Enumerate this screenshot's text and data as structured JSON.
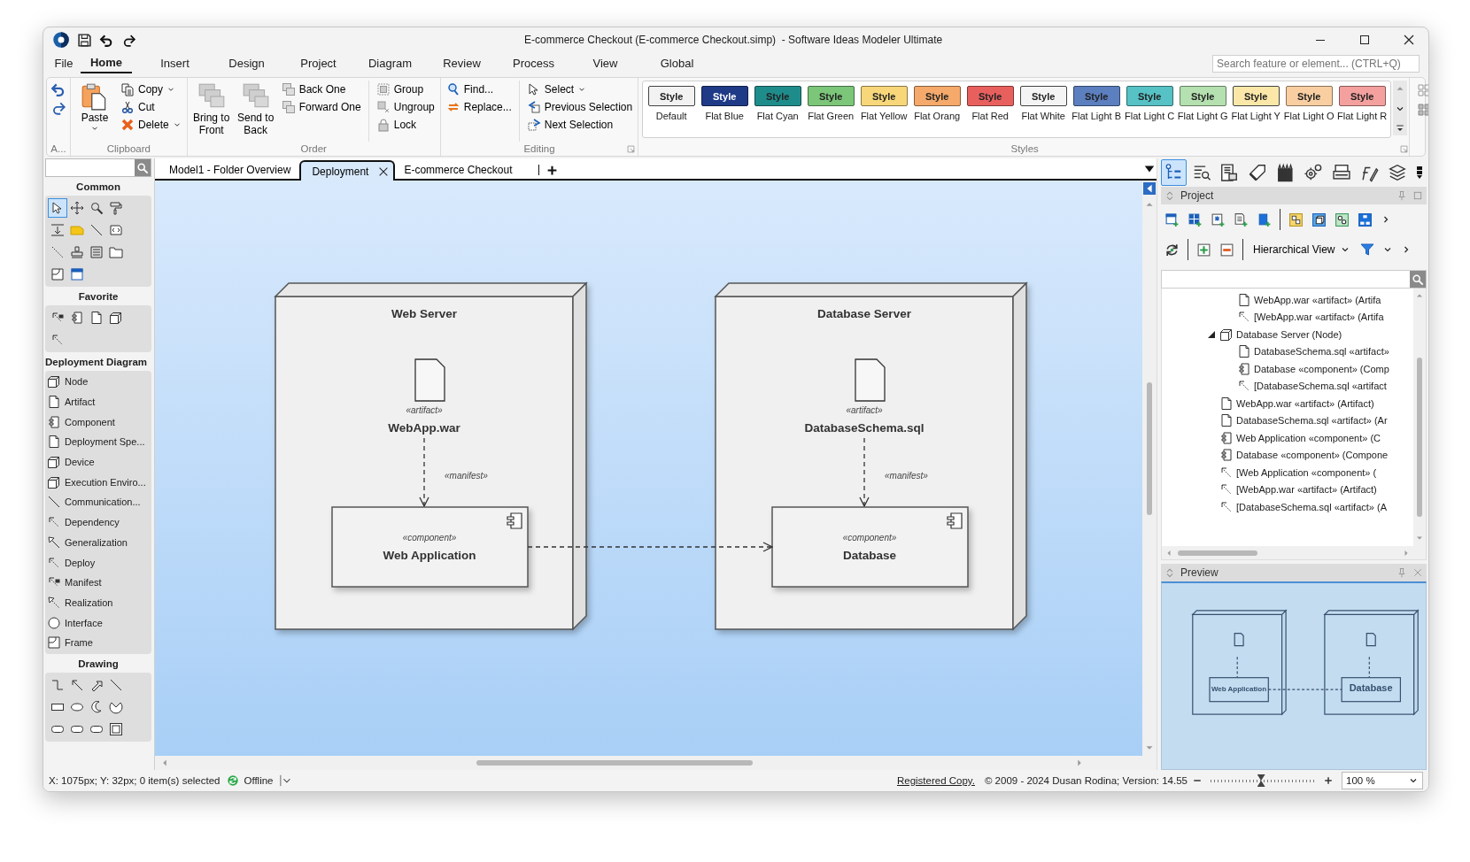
{
  "window": {
    "title": "E-commerce Checkout (E-commerce Checkout.simp)  - Software Ideas Modeler Ultimate"
  },
  "menu": [
    {
      "label": "File",
      "selected": false
    },
    {
      "label": "Home",
      "selected": true
    },
    {
      "label": "Insert",
      "selected": false
    },
    {
      "label": "Design",
      "selected": false
    },
    {
      "label": "Project",
      "selected": false
    },
    {
      "label": "Diagram",
      "selected": false
    },
    {
      "label": "Review",
      "selected": false
    },
    {
      "label": "Process",
      "selected": false
    },
    {
      "label": "View",
      "selected": false
    },
    {
      "label": "Global",
      "selected": false
    }
  ],
  "feature_search": {
    "placeholder": "Search feature or element... (CTRL+Q)"
  },
  "ribbon": [
    {
      "label": "A...",
      "columns": [
        [
          {
            "kind": "icon"
          },
          {
            "kind": "icon"
          }
        ]
      ]
    },
    {
      "label": "Clipboard",
      "columns": [
        [
          {
            "kind": "large",
            "label": "Paste",
            "dropdown": true
          }
        ],
        [
          {
            "kind": "small",
            "label": "Copy",
            "dropdown": true
          },
          {
            "kind": "small",
            "label": "Cut",
            "dropdown": false
          },
          {
            "kind": "small",
            "label": "Delete",
            "dropdown": true
          }
        ]
      ]
    },
    {
      "label": "Order",
      "columns": [
        [
          {
            "kind": "large",
            "label": "Bring to Front",
            "dropdown": false
          }
        ],
        [
          {
            "kind": "large",
            "label": "Send to Back",
            "dropdown": false
          }
        ],
        [
          {
            "kind": "small",
            "label": "Back One",
            "dropdown": false
          },
          {
            "kind": "small",
            "label": "Forward One",
            "dropdown": false
          }
        ],
        [
          {
            "kind": "small",
            "label": "Group",
            "dropdown": false
          },
          {
            "kind": "small",
            "label": "Ungroup",
            "dropdown": false
          },
          {
            "kind": "small",
            "label": "Lock",
            "dropdown": false
          }
        ]
      ]
    },
    {
      "label": "Editing",
      "columns": [
        [
          {
            "kind": "small",
            "label": "Find...",
            "dropdown": false
          },
          {
            "kind": "small",
            "label": "Replace...",
            "dropdown": false
          }
        ],
        [
          {
            "kind": "small",
            "label": "Select",
            "dropdown": true
          },
          {
            "kind": "small",
            "label": "Previous Selection",
            "dropdown": false
          },
          {
            "kind": "small",
            "label": "Next Selection",
            "dropdown": false
          }
        ]
      ]
    }
  ],
  "styles": {
    "label": "Styles",
    "items": [
      {
        "swatch": "Style",
        "name": "Default",
        "color": "#f2f2f2"
      },
      {
        "swatch": "Style",
        "name": "Flat Blue",
        "color": "#1f3a86"
      },
      {
        "swatch": "Style",
        "name": "Flat Cyan",
        "color": "#1f8c8c"
      },
      {
        "swatch": "Style",
        "name": "Flat Green",
        "color": "#7cc67a"
      },
      {
        "swatch": "Style",
        "name": "Flat Yellow",
        "color": "#f7d77a"
      },
      {
        "swatch": "Style",
        "name": "Flat Orang",
        "color": "#f5a96b"
      },
      {
        "swatch": "Style",
        "name": "Flat Red",
        "color": "#e8605e"
      },
      {
        "swatch": "Style",
        "name": "Flat White",
        "color": "#f4f4f4"
      },
      {
        "swatch": "Style",
        "name": "Flat Light B",
        "color": "#5b7fbf"
      },
      {
        "swatch": "Style",
        "name": "Flat Light C",
        "color": "#56c2c5"
      },
      {
        "swatch": "Style",
        "name": "Flat Light G",
        "color": "#b5e0b0"
      },
      {
        "swatch": "Style",
        "name": "Flat Light Y",
        "color": "#fbe8a8"
      },
      {
        "swatch": "Style",
        "name": "Flat Light O",
        "color": "#f9cfa2"
      },
      {
        "swatch": "Style",
        "name": "Flat Light R",
        "color": "#f3a09e"
      }
    ]
  },
  "toolbox": {
    "sections": [
      {
        "title": "Common",
        "kind": "icons",
        "tools": [
          {
            "selected": true
          },
          {
            "selected": false
          },
          {
            "selected": false
          },
          {
            "selected": false
          },
          {
            "selected": false
          },
          {
            "selected": false
          },
          {
            "selected": false
          },
          {
            "selected": false
          },
          {
            "selected": false
          },
          {
            "selected": false
          },
          {
            "selected": false
          },
          {
            "selected": false
          },
          {
            "selected": false
          },
          {
            "selected": false
          }
        ]
      },
      {
        "title": "Favorite",
        "kind": "icons",
        "tools": [
          {
            "selected": false
          },
          {
            "selected": false
          },
          {
            "selected": false
          },
          {
            "selected": false
          },
          {
            "selected": false
          }
        ]
      },
      {
        "title": "Deployment Diagram",
        "kind": "list",
        "items": [
          {
            "label": "Node",
            "kind": "node"
          },
          {
            "label": "Artifact",
            "kind": "artifact"
          },
          {
            "label": "Component",
            "kind": "component"
          },
          {
            "label": "Deployment Spe...",
            "kind": "artifact"
          },
          {
            "label": "Device",
            "kind": "node"
          },
          {
            "label": "Execution Enviro...",
            "kind": "node"
          },
          {
            "label": "Communication...",
            "kind": "line"
          },
          {
            "label": "Dependency",
            "kind": "dependency"
          },
          {
            "label": "Generalization",
            "kind": "generalization"
          },
          {
            "label": "Deploy",
            "kind": "dependency"
          },
          {
            "label": "Manifest",
            "kind": "manifest"
          },
          {
            "label": "Realization",
            "kind": "realization"
          },
          {
            "label": "Interface",
            "kind": "interface"
          },
          {
            "label": "Frame",
            "kind": "frame"
          }
        ]
      },
      {
        "title": "Drawing",
        "kind": "icons",
        "tools": [
          {
            "selected": false
          },
          {
            "selected": false
          },
          {
            "selected": false
          },
          {
            "selected": false
          },
          {
            "selected": false
          },
          {
            "selected": false
          },
          {
            "selected": false
          },
          {
            "selected": false
          },
          {
            "selected": false
          },
          {
            "selected": false
          },
          {
            "selected": false
          },
          {
            "selected": false
          }
        ]
      }
    ]
  },
  "tabs": [
    {
      "label": "Model1 - Folder Overview",
      "selected": false
    },
    {
      "label": "Deployment",
      "selected": true
    },
    {
      "label": "E-commerce Checkout",
      "selected": false
    }
  ],
  "diagram": {
    "nodes": [
      {
        "title": "Web Server",
        "artifact": {
          "stereotype": "«artifact»",
          "name": "WebApp.war"
        },
        "manifest": "«manifest»",
        "component": {
          "stereotype": "«component»",
          "name": "Web Application"
        }
      },
      {
        "title": "Database Server",
        "artifact": {
          "stereotype": "«artifact»",
          "name": "DatabaseSchema.sql"
        },
        "manifest": "«manifest»",
        "component": {
          "stereotype": "«component»",
          "name": "Database"
        }
      }
    ]
  },
  "project": {
    "title": "Project",
    "view": "Hierarchical View",
    "tree": [
      {
        "children": [
          {
            "label": "WebApp.war «artifact» (Artifa",
            "kind": "artifact"
          },
          {
            "label": "[WebApp.war «artifact» (Artifa",
            "kind": "dependency"
          }
        ]
      },
      {
        "label": "Database Server (Node)",
        "kind": "node",
        "expanded": true,
        "children": [
          {
            "label": "DatabaseSchema.sql «artifact»",
            "kind": "artifact"
          },
          {
            "label": "Database «component» (Comp",
            "kind": "component"
          },
          {
            "label": "[DatabaseSchema.sql «artifact",
            "kind": "dependency"
          }
        ]
      },
      {
        "label": "WebApp.war «artifact» (Artifact)",
        "kind": "artifact"
      },
      {
        "label": "DatabaseSchema.sql «artifact» (Ar",
        "kind": "artifact"
      },
      {
        "label": "Web Application «component» (C",
        "kind": "component"
      },
      {
        "label": "Database «component» (Compone",
        "kind": "component"
      },
      {
        "label": "[Web Application «component» (",
        "kind": "dependency"
      },
      {
        "label": "[WebApp.war «artifact» (Artifact)",
        "kind": "dependency"
      },
      {
        "label": "[DatabaseSchema.sql «artifact» (A",
        "kind": "dependency"
      }
    ]
  },
  "preview": {
    "title": "Preview",
    "labels": [
      "Web Application",
      "Database"
    ]
  },
  "status": {
    "position": "X: 1075px; Y: 32px; 0 item(s) selected",
    "connection": "Offline",
    "registered": "Registered Copy.",
    "copyright": "© 2009 - 2024 Dusan Rodina; Version: 14.55",
    "zoom": {
      "level": 0.48,
      "value": "100 %"
    }
  }
}
